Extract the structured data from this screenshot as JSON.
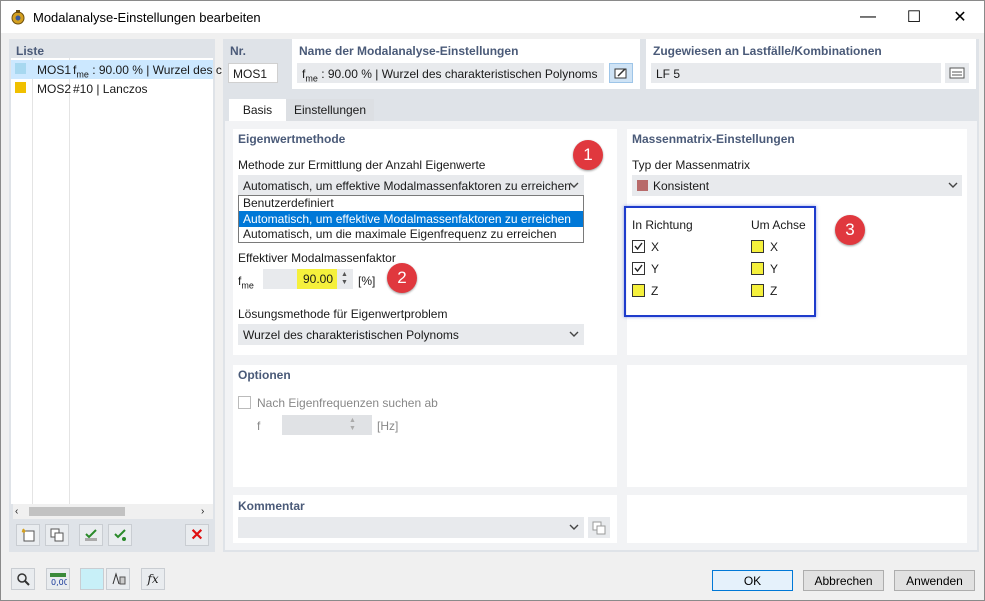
{
  "window": {
    "title": "Modalanalyse-Einstellungen bearbeiten",
    "minimize": "—",
    "maximize": "☐",
    "close": "✕"
  },
  "list": {
    "header": "Liste",
    "items": [
      {
        "id": "MOS1",
        "prefix": "f",
        "sub": "me",
        "text": ": 90.00 % | Wurzel des c",
        "color": "#a7d8f0"
      },
      {
        "id": "MOS2",
        "prefix": "",
        "sub": "",
        "text": "#10 | Lanczos",
        "color": "#f0c000"
      }
    ]
  },
  "nr": {
    "label": "Nr.",
    "value": "MOS1"
  },
  "name": {
    "label": "Name der Modalanalyse-Einstellungen",
    "prefix": "f",
    "sub": "me",
    "value": ": 90.00 % | Wurzel des charakteristischen Polynoms"
  },
  "assigned": {
    "label": "Zugewiesen an Lastfälle/Kombinationen",
    "value": "LF 5"
  },
  "tabs": [
    "Basis",
    "Einstellungen"
  ],
  "eigen": {
    "title": "Eigenwertmethode",
    "method_label": "Methode zur Ermittlung der Anzahl Eigenwerte",
    "method_value": "Automatisch, um effektive Modalmassenfaktoren zu erreichen",
    "options": [
      "Benutzerdefiniert",
      "Automatisch, um effektive Modalmassenfaktoren zu erreichen",
      "Automatisch, um die maximale Eigenfrequenz zu erreichen"
    ],
    "factor_label": "Effektiver Modalmassenfaktor",
    "factor_sym": "f",
    "factor_sub": "me",
    "factor_value": "90.00",
    "factor_unit": "[%]",
    "solution_label": "Lösungsmethode für Eigenwertproblem",
    "solution_value": "Wurzel des charakteristischen Polynoms"
  },
  "mass": {
    "title": "Massenmatrix-Einstellungen",
    "type_label": "Typ der Massenmatrix",
    "type_value": "Konsistent",
    "type_color": "#b86a6a",
    "dir_header": "In Richtung",
    "axis_header": "Um Achse",
    "dirs": [
      "X",
      "Y",
      "Z"
    ],
    "axes": [
      "X",
      "Y",
      "Z"
    ]
  },
  "options": {
    "title": "Optionen",
    "search_label": "Nach Eigenfrequenzen suchen ab",
    "f_label": "f",
    "f_unit": "[Hz]"
  },
  "comment": {
    "title": "Kommentar"
  },
  "badges": [
    "1",
    "2",
    "3"
  ],
  "buttons": {
    "ok": "OK",
    "cancel": "Abbrechen",
    "apply": "Anwenden"
  },
  "colors": {
    "selection": "#0078d7",
    "badge": "#e0383e",
    "highlight_border": "#1e3ccc"
  }
}
